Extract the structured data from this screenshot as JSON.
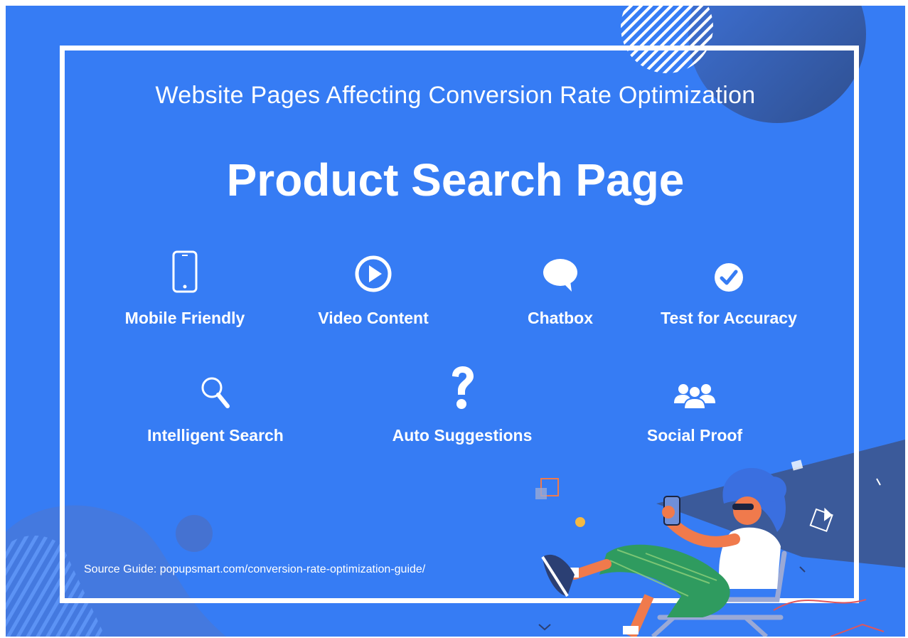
{
  "subtitle": "Website Pages Affecting  Conversion Rate Optimization",
  "title": "Product Search Page",
  "features": [
    {
      "label": "Mobile Friendly",
      "icon": "mobile-phone-icon"
    },
    {
      "label": "Video Content",
      "icon": "play-icon"
    },
    {
      "label": "Chatbox",
      "icon": "chat-bubble-icon"
    },
    {
      "label": "Test for Accuracy",
      "icon": "check-circle-icon"
    },
    {
      "label": "Intelligent Search",
      "icon": "magnifier-icon"
    },
    {
      "label": "Auto Suggestions",
      "icon": "question-mark-icon"
    },
    {
      "label": "Social Proof",
      "icon": "users-group-icon"
    }
  ],
  "source": "Source Guide: popupsmart.com/conversion-rate-optimization-guide/",
  "colors": {
    "background": "#367cf4",
    "text": "#ffffff",
    "dark_accent": "#3b5a9a",
    "illustration_orange": "#f07a4c",
    "illustration_green": "#2f9b5f"
  }
}
